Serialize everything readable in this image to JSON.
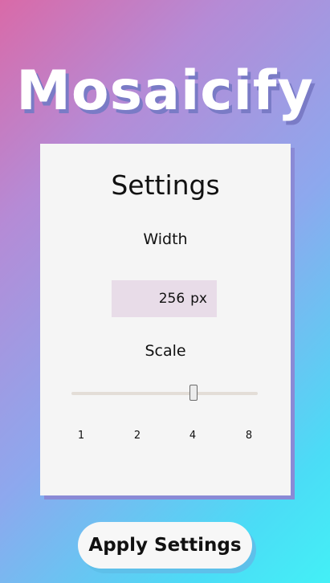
{
  "app": {
    "title": "Mosaicify"
  },
  "settings": {
    "title": "Settings",
    "width": {
      "label": "Width",
      "value": "256",
      "unit": "px"
    },
    "scale": {
      "label": "Scale",
      "ticks": [
        "1",
        "2",
        "4",
        "8"
      ],
      "selected": "4"
    }
  },
  "actions": {
    "apply_label": "Apply Settings"
  },
  "colors": {
    "gradient_start": "#d96aa8",
    "gradient_end": "#43f0f6",
    "card_background": "#f5f5f5",
    "input_background": "#e8dce8",
    "card_shadow": "#8a8ad6",
    "button_shadow": "#5ec0ea"
  }
}
